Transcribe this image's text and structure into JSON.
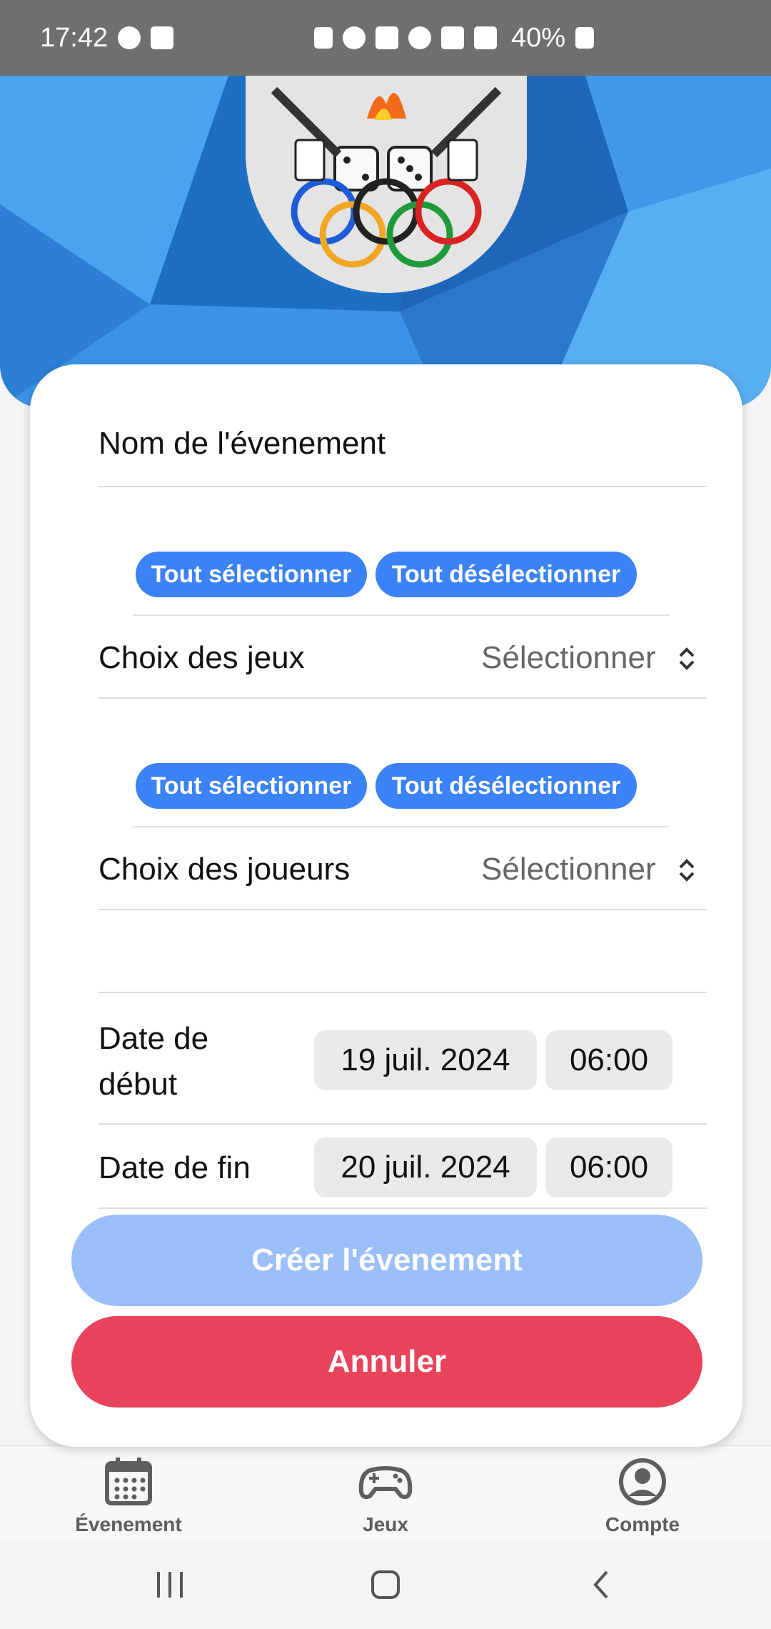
{
  "status_bar": {
    "time": "17:42",
    "battery": "40%",
    "icons": [
      "messenger-icon",
      "gallery-icon",
      "battery-saver-icon",
      "alarm-icon",
      "mute-icon",
      "hotspot-icon",
      "network-4g-icon",
      "signal-icon",
      "battery-icon"
    ]
  },
  "form": {
    "event_name_placeholder": "Nom de l'évenement",
    "games": {
      "select_all": "Tout sélectionner",
      "deselect_all": "Tout désélectionner",
      "label": "Choix des jeux",
      "value": "Sélectionner"
    },
    "players": {
      "select_all": "Tout sélectionner",
      "deselect_all": "Tout désélectionner",
      "label": "Choix des joueurs",
      "value": "Sélectionner"
    },
    "start": {
      "label": "Date de début",
      "date": "19 juil. 2024",
      "time": "06:00"
    },
    "end": {
      "label": "Date de fin",
      "date": "20 juil. 2024",
      "time": "06:00"
    },
    "create_button": "Créer l'évenement",
    "cancel_button": "Annuler"
  },
  "tabs": [
    {
      "label": "Évenement",
      "icon": "calendar-icon"
    },
    {
      "label": "Jeux",
      "icon": "gamepad-icon"
    },
    {
      "label": "Compte",
      "icon": "account-icon"
    }
  ],
  "colors": {
    "accent": "#3b82f6",
    "create_disabled": "#9bbffa",
    "cancel": "#e8435b",
    "hero": "#2f86dc"
  }
}
